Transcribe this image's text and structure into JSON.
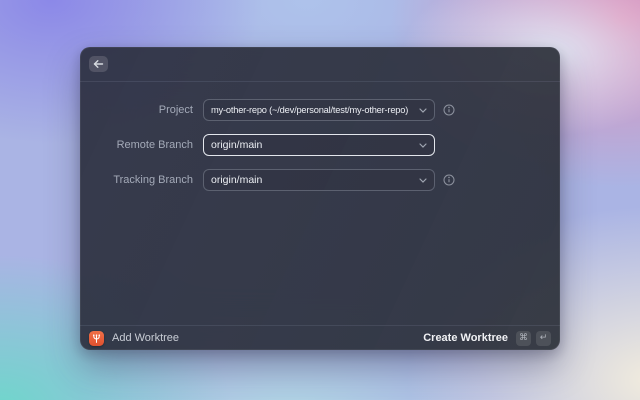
{
  "form": {
    "rows": [
      {
        "label": "Project",
        "value": "my-other-repo (~/dev/personal/test/my-other-repo)",
        "has_info": true,
        "focused": false
      },
      {
        "label": "Remote Branch",
        "value": "origin/main",
        "has_info": false,
        "focused": true
      },
      {
        "label": "Tracking Branch",
        "value": "origin/main",
        "has_info": true,
        "focused": false
      }
    ]
  },
  "footer": {
    "title": "Add Worktree",
    "submit_label": "Create Worktree",
    "shortcut_keys": [
      "⌘",
      "↵"
    ]
  },
  "icons": {
    "back": "arrow-left-icon",
    "dropdown": "chevron-down-icon",
    "row_help": "info-circle-icon",
    "app_badge": "git-worktree-icon"
  },
  "colors": {
    "accent_orange": "#e4583a",
    "panel": "#2a2d3a",
    "focus_border": "#e3e6ec"
  }
}
